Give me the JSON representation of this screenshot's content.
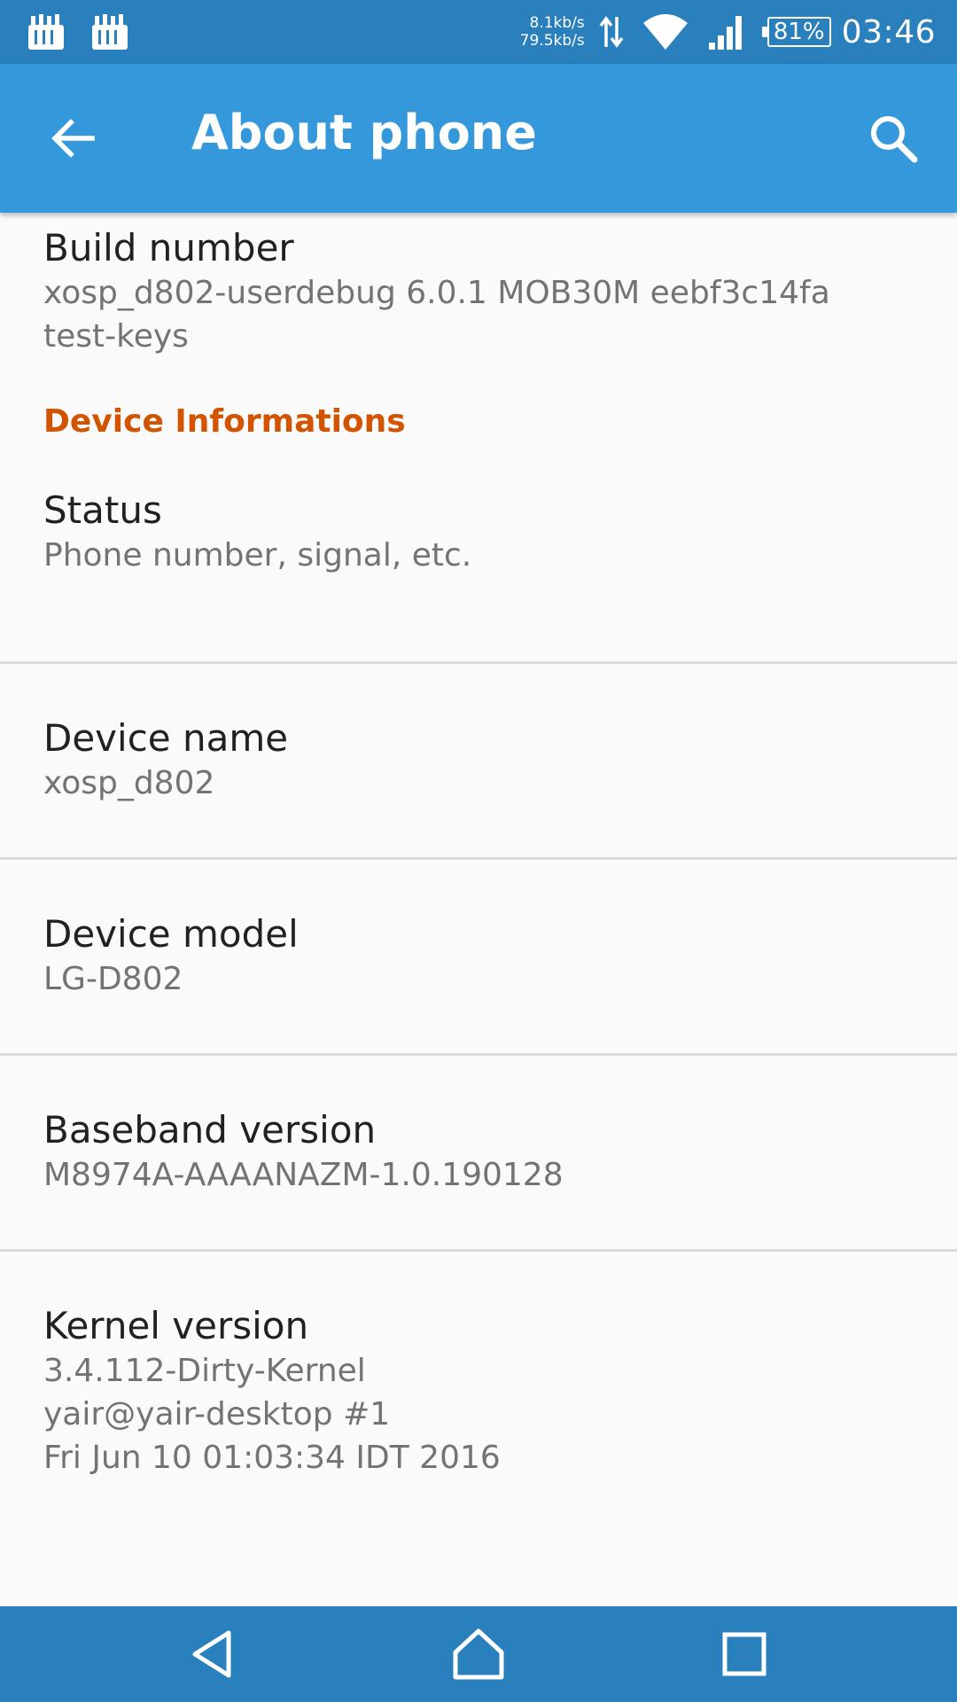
{
  "status_bar": {
    "net_up": "8.1kb/s",
    "net_down": "79.5kb/s",
    "battery": "81%",
    "time": "03:46",
    "icons": [
      "app-notification-icon",
      "app-notification-icon",
      "data-transfer-icon",
      "wifi-icon",
      "cell-signal-icon",
      "battery-icon"
    ]
  },
  "app_bar": {
    "title": "About phone",
    "back_icon": "arrow-left-icon",
    "search_icon": "search-icon"
  },
  "build": {
    "title": "Build number",
    "summary": "xosp_d802-userdebug 6.0.1 MOB30M eebf3c14fa\ntest-keys"
  },
  "category": "Device Informations",
  "items": [
    {
      "title": "Status",
      "summary": "Phone number, signal, etc."
    },
    {
      "title": "Device name",
      "summary": "xosp_d802"
    },
    {
      "title": "Device model",
      "summary": "LG-D802"
    },
    {
      "title": "Baseband version",
      "summary": "M8974A-AAAANAZM-1.0.190128"
    },
    {
      "title": "Kernel version",
      "summary": "3.4.112-Dirty-Kernel\nyair@yair-desktop #1\nFri Jun 10 01:03:34 IDT 2016"
    }
  ],
  "nav_bar": {
    "back": "back-triangle-icon",
    "home": "home-icon",
    "recents": "recents-square-icon"
  },
  "colors": {
    "status_bar": "#2a7fbd",
    "app_bar": "#3498db",
    "category": "#d35400"
  }
}
